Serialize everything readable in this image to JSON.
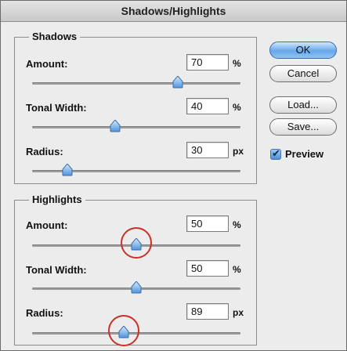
{
  "window": {
    "title": "Shadows/Highlights"
  },
  "shadows": {
    "legend": "Shadows",
    "amount": {
      "label": "Amount:",
      "value": "70",
      "unit": "%",
      "slider_fraction": 0.7
    },
    "tonal_width": {
      "label": "Tonal Width:",
      "value": "40",
      "unit": "%",
      "slider_fraction": 0.4
    },
    "radius": {
      "label": "Radius:",
      "value": "30",
      "unit": "px",
      "slider_fraction": 0.17
    }
  },
  "highlights": {
    "legend": "Highlights",
    "amount": {
      "label": "Amount:",
      "value": "50",
      "unit": "%",
      "slider_fraction": 0.5
    },
    "tonal_width": {
      "label": "Tonal Width:",
      "value": "50",
      "unit": "%",
      "slider_fraction": 0.5
    },
    "radius": {
      "label": "Radius:",
      "value": "89",
      "unit": "px",
      "slider_fraction": 0.44
    }
  },
  "buttons": {
    "ok": "OK",
    "cancel": "Cancel",
    "load": "Load...",
    "save": "Save..."
  },
  "preview": {
    "label": "Preview",
    "checked": true
  },
  "colors": {
    "accent": "#67a8ea",
    "annotation": "#c8302a"
  }
}
